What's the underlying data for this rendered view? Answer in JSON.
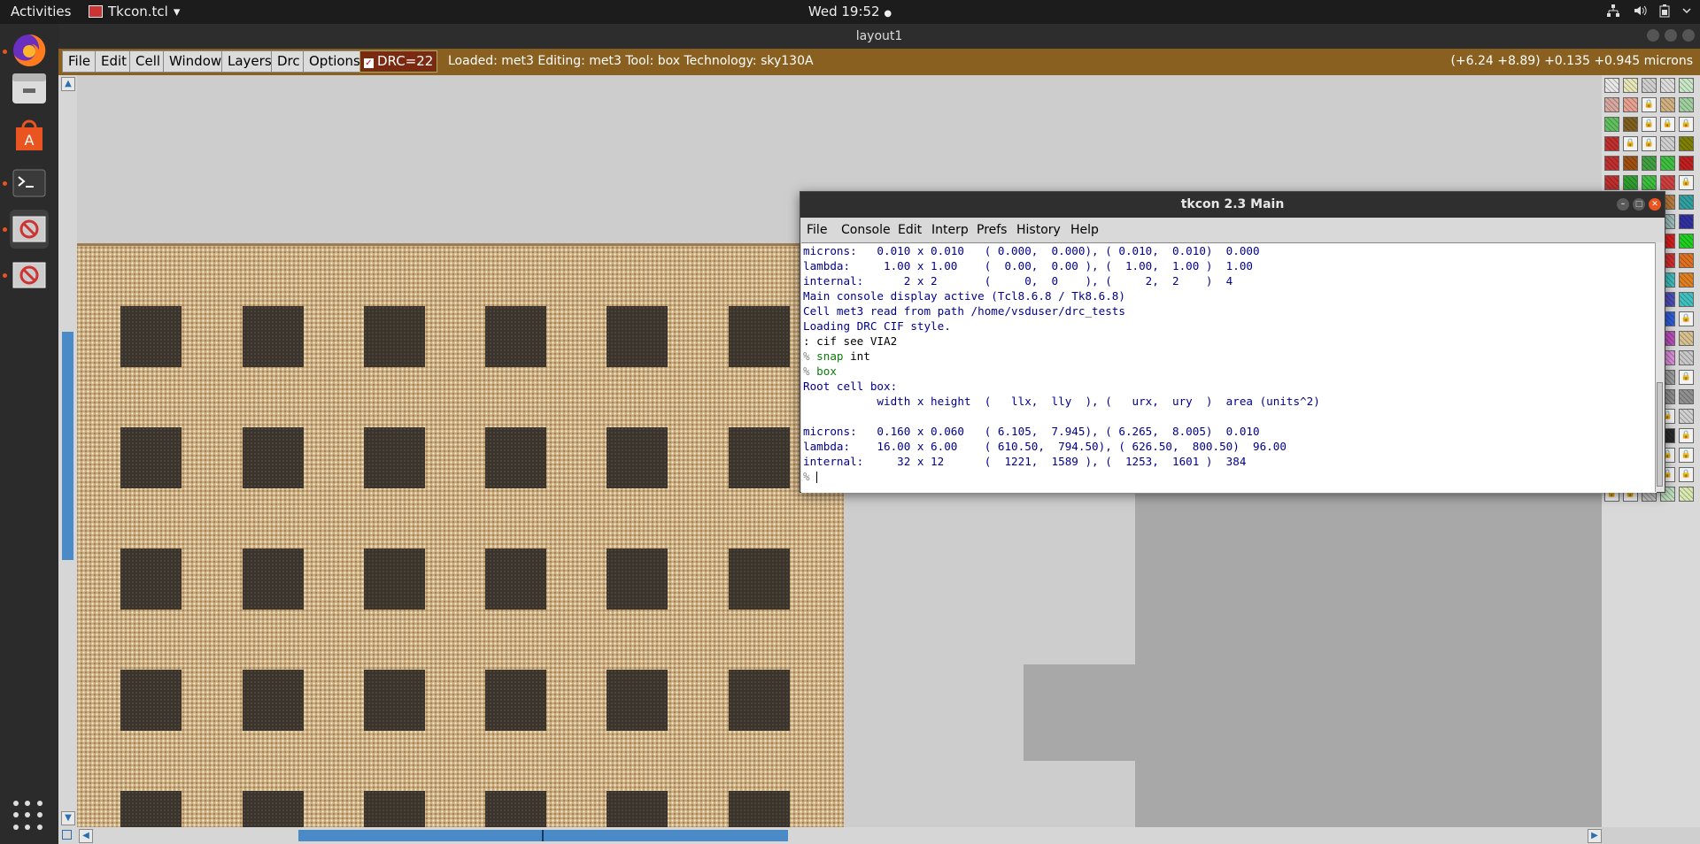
{
  "topbar": {
    "activities": "Activities",
    "app_name": "Tkcon.tcl",
    "app_menu_arrow": "▾",
    "clock": "Wed 19:52",
    "clock_dot": "●",
    "icons": [
      "network-icon",
      "volume-icon",
      "battery-icon",
      "system-menu-icon"
    ]
  },
  "dock": {
    "items": [
      "firefox",
      "files",
      "ubuntu-software",
      "terminal",
      "magic-window-1",
      "magic-window-2"
    ],
    "show_apps": "show-applications-icon"
  },
  "window": {
    "title": "layout1"
  },
  "magic": {
    "menu": [
      "File",
      "Edit",
      "Cell",
      "Window",
      "Layers",
      "Drc",
      "Options"
    ],
    "drc_check": "✓",
    "drc_label": "DRC=22",
    "status": "Loaded: met3 Editing: met3 Tool: box  Technology: sky130A",
    "coords": "(+6.24 +8.89) +0.135 +0.945 microns",
    "accent": "#8a6020",
    "met3_color": "#c9a97e",
    "via_color": "#3a342c"
  },
  "tkcon": {
    "title": "tkcon 2.3 Main",
    "menu": [
      "File",
      "Console",
      "Edit",
      "Interp",
      "Prefs",
      "History",
      "Help"
    ],
    "lines": [
      {
        "text": "microns:   0.010 x 0.010   ( 0.000,  0.000), ( 0.010,  0.010)  0.000"
      },
      {
        "text": "lambda:     1.00 x 1.00    (  0.00,  0.00 ), (  1.00,  1.00 )  1.00"
      },
      {
        "text": "internal:      2 x 2       (     0,  0    ), (     2,  2    )  4"
      },
      {
        "text": "Main console display active (Tcl8.6.8 / Tk8.6.8)"
      },
      {
        "text": "Cell met3 read from path /home/vsduser/drc_tests"
      },
      {
        "text": "Loading DRC CIF style."
      },
      {
        "text": ": cif see VIA2",
        "kind": "cmd-black"
      },
      {
        "prompt": "% ",
        "cmd": "snap",
        "arg": " int"
      },
      {
        "prompt": "% ",
        "cmd": "box",
        "arg": ""
      },
      {
        "text": "Root cell box:"
      },
      {
        "text": "           width x height  (   llx,  lly  ), (   urx,  ury  )  area (units^2)"
      },
      {
        "text": ""
      },
      {
        "text": "microns:   0.160 x 0.060   ( 6.105,  7.945), ( 6.265,  8.005)  0.010"
      },
      {
        "text": "lambda:    16.00 x 6.00    ( 610.50,  794.50), ( 626.50,  800.50)  96.00"
      },
      {
        "text": "internal:     32 x 12      (  1221,  1589 ), (  1253,  1601 )  384"
      },
      {
        "prompt": "% ",
        "cmd": "",
        "arg": "",
        "cursor": true
      }
    ]
  }
}
